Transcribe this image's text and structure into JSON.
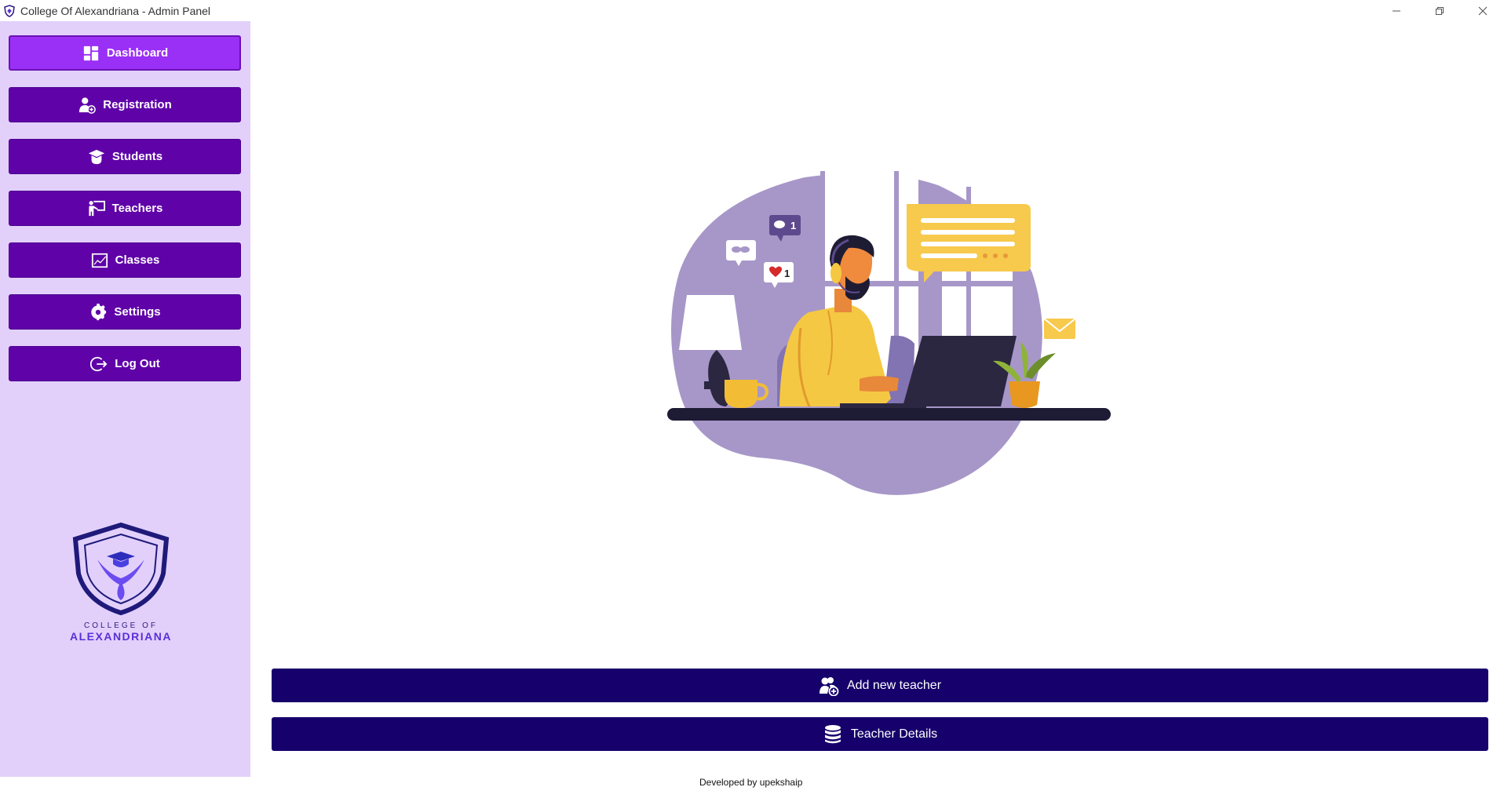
{
  "window": {
    "title": "College Of Alexandriana - Admin Panel"
  },
  "sidebar": {
    "items": [
      {
        "label": "Dashboard",
        "icon": "dashboard-icon",
        "active": true
      },
      {
        "label": "Registration",
        "icon": "add-user-icon"
      },
      {
        "label": "Students",
        "icon": "graduation-cap-icon"
      },
      {
        "label": "Teachers",
        "icon": "teacher-board-icon"
      },
      {
        "label": "Classes",
        "icon": "chart-icon"
      },
      {
        "label": "Settings",
        "icon": "gear-icon"
      },
      {
        "label": "Log Out",
        "icon": "logout-icon"
      }
    ],
    "logo": {
      "line1": "COLLEGE OF",
      "line2": "ALEXANDRIANA"
    }
  },
  "main": {
    "illustration": {
      "badge_messages": "1",
      "badge_likes": "1"
    },
    "actions": [
      {
        "label": "Add new teacher",
        "icon": "add-teacher-icon"
      },
      {
        "label": "Teacher Details",
        "icon": "database-icon"
      }
    ]
  },
  "footer": {
    "text": "Developed by upekshaip"
  },
  "colors": {
    "sidebar_bg": "#e2d0fb",
    "nav_button": "#5f03a8",
    "nav_button_active": "#9a2ff5",
    "action_button": "#16006b"
  }
}
